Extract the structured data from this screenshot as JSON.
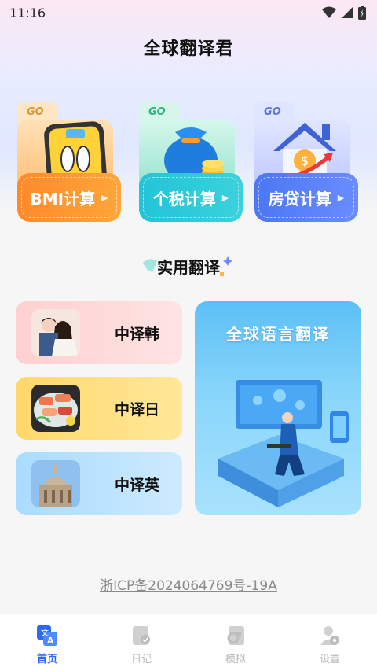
{
  "status_bar": {
    "time": "11:16"
  },
  "app": {
    "title": "全球翻译君"
  },
  "calculators": {
    "go_label": "GO",
    "bmi": {
      "label": "BMI计算",
      "icon": "scale-icon"
    },
    "tax": {
      "label": "个税计算",
      "icon": "money-bag-icon"
    },
    "loan": {
      "label": "房贷计算",
      "icon": "house-icon"
    }
  },
  "section": {
    "title": "实用翻译"
  },
  "translate": {
    "items": [
      {
        "label": "中译韩",
        "icon": "korean-couple-thumbnail"
      },
      {
        "label": "中译日",
        "icon": "sushi-thumbnail"
      },
      {
        "label": "中译英",
        "icon": "st-pauls-cathedral-thumbnail"
      }
    ],
    "global": {
      "title": "全球语言翻译",
      "icon": "world-map-person-illustration"
    }
  },
  "footer": {
    "icp": "浙ICP备2024064769号-19A"
  },
  "tab_bar": {
    "tabs": [
      {
        "label": "首页",
        "icon": "translate-icon",
        "active": true
      },
      {
        "label": "日记",
        "icon": "diary-icon",
        "active": false
      },
      {
        "label": "模拟",
        "icon": "simulate-icon",
        "active": false
      },
      {
        "label": "设置",
        "icon": "settings-icon",
        "active": false
      }
    ]
  },
  "colors": {
    "accent": "#2e6af0",
    "bmi": "#ff8a2a",
    "tax": "#23c3d8",
    "loan": "#4c77f3"
  }
}
